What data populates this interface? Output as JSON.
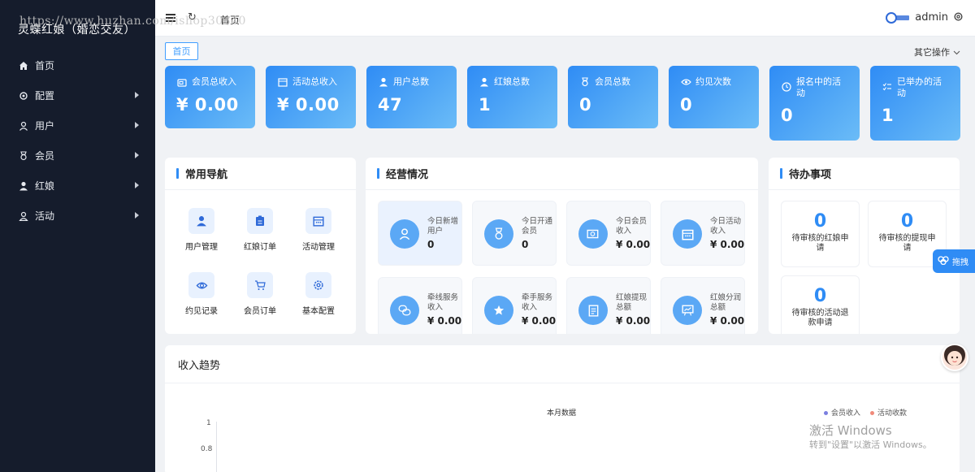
{
  "watermark": {
    "url_text": "https://www.huzhan.com/ishop30340"
  },
  "sidebar": {
    "brand": "灵蝶红娘（婚恋交友）",
    "items": [
      {
        "label": "首页",
        "icon": "home-icon",
        "has_arrow": false
      },
      {
        "label": "配置",
        "icon": "gear-icon",
        "has_arrow": true
      },
      {
        "label": "用户",
        "icon": "user-icon",
        "has_arrow": true
      },
      {
        "label": "会员",
        "icon": "medal-icon",
        "has_arrow": true
      },
      {
        "label": "红娘",
        "icon": "person-icon",
        "has_arrow": true
      },
      {
        "label": "活动",
        "icon": "user-outline-icon",
        "has_arrow": true
      }
    ]
  },
  "topbar": {
    "breadcrumb": "首页",
    "username": "admin"
  },
  "tabs": {
    "home": "首页",
    "other_ops": "其它操作"
  },
  "stats": [
    {
      "label": "会员总收入",
      "value": "¥ 0.00",
      "icon": "wallet-icon"
    },
    {
      "label": "活动总收入",
      "value": "¥ 0.00",
      "icon": "calendar-icon"
    },
    {
      "label": "用户总数",
      "value": "47",
      "icon": "user-icon"
    },
    {
      "label": "红娘总数",
      "value": "1",
      "icon": "person-icon"
    },
    {
      "label": "会员总数",
      "value": "0",
      "icon": "medal-icon"
    },
    {
      "label": "约见次数",
      "value": "0",
      "icon": "eye-icon"
    },
    {
      "label": "报名中的活动",
      "value": "0",
      "icon": "clock-icon"
    },
    {
      "label": "已举办的活动",
      "value": "1",
      "icon": "checklist-icon"
    }
  ],
  "common_nav": {
    "title": "常用导航",
    "items": [
      {
        "label": "用户管理",
        "icon": "user-icon"
      },
      {
        "label": "红娘订单",
        "icon": "clipboard-icon"
      },
      {
        "label": "活动管理",
        "icon": "calendar-icon"
      },
      {
        "label": "约见记录",
        "icon": "eye-icon"
      },
      {
        "label": "会员订单",
        "icon": "cart-icon"
      },
      {
        "label": "基本配置",
        "icon": "gear-icon"
      }
    ]
  },
  "business": {
    "title": "经营情况",
    "items": [
      {
        "label": "今日新增用户",
        "value": "0",
        "icon": "user-icon"
      },
      {
        "label": "今日开通会员",
        "value": "0",
        "icon": "medal-icon"
      },
      {
        "label": "今日会员收入",
        "value": "¥ 0.00",
        "icon": "money-icon"
      },
      {
        "label": "今日活动收入",
        "value": "¥ 0.00",
        "icon": "calendar-icon"
      },
      {
        "label": "牵线服务收入",
        "value": "¥ 0.00",
        "icon": "chat-icon"
      },
      {
        "label": "牵手服务收入",
        "value": "¥ 0.00",
        "icon": "star-icon"
      },
      {
        "label": "红娘提现总额",
        "value": "¥ 0.00",
        "icon": "document-icon"
      },
      {
        "label": "红娘分润总额",
        "value": "¥ 0.00",
        "icon": "board-icon"
      }
    ]
  },
  "todo": {
    "title": "待办事项",
    "items": [
      {
        "value": "0",
        "label": "待审核的红娘申请"
      },
      {
        "value": "0",
        "label": "待审核的提现申请"
      },
      {
        "value": "0",
        "label": "待审核的活动退款申请"
      }
    ]
  },
  "chart": {
    "title": "收入趋势",
    "subtitle": "本月数据"
  },
  "chart_data": {
    "type": "line",
    "title": "本月数据",
    "series": [
      {
        "name": "会员收入",
        "values": []
      },
      {
        "name": "活动收款",
        "values": []
      }
    ],
    "y_ticks": [
      "1",
      "0.8"
    ],
    "legend_position": "top-right",
    "colors": {
      "会员收入": "#7b7fe0",
      "活动收款": "#f08a7a"
    }
  },
  "floating": {
    "drag_label": "拖拽"
  },
  "win_watermark": {
    "line1": "激活 Windows",
    "line2": "转到\"设置\"以激活 Windows。"
  }
}
